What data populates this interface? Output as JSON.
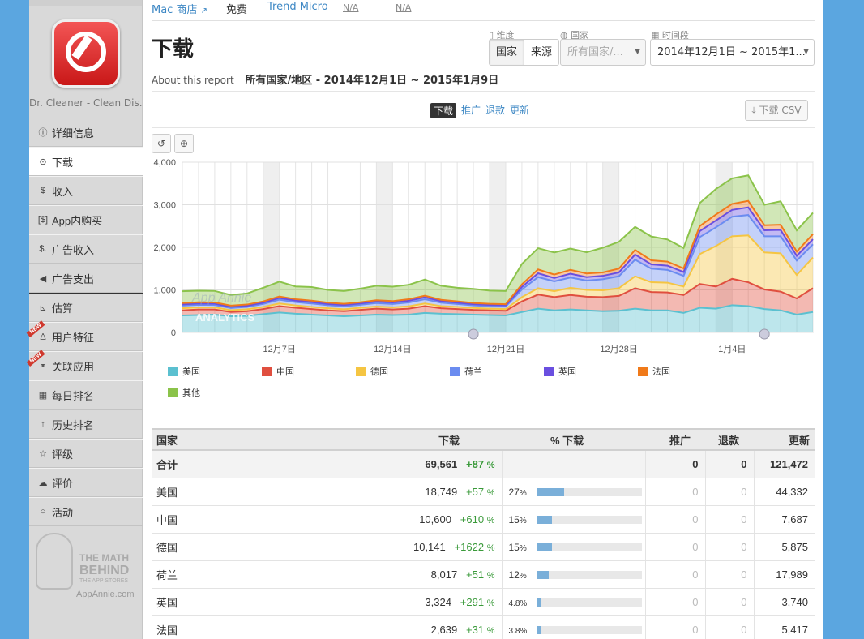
{
  "topbar": {
    "store": "Mac 商店",
    "price": "免费",
    "publisher": "Trend Micro",
    "na1": "N/A",
    "na2": "N/A"
  },
  "sidebar": {
    "app_name": "Dr. Cleaner - Clean Dis...",
    "items": [
      {
        "label": "详细信息",
        "icon": "info-icon"
      },
      {
        "label": "下载",
        "icon": "download-icon"
      },
      {
        "label": "收入",
        "icon": "dollar-icon"
      },
      {
        "label": "App内购买",
        "icon": "iap-icon"
      },
      {
        "label": "广告收入",
        "icon": "ad-revenue-icon"
      },
      {
        "label": "广告支出",
        "icon": "megaphone-icon"
      },
      {
        "label": "估算",
        "icon": "chart-icon"
      },
      {
        "label": "用户特征",
        "icon": "user-icon"
      },
      {
        "label": "关联应用",
        "icon": "link-icon"
      },
      {
        "label": "每日排名",
        "icon": "calendar-icon"
      },
      {
        "label": "历史排名",
        "icon": "arrow-up-icon"
      },
      {
        "label": "评级",
        "icon": "star-icon"
      },
      {
        "label": "评价",
        "icon": "comments-icon"
      },
      {
        "label": "活动",
        "icon": "comment-icon"
      }
    ],
    "new_badge": "NEW",
    "promo": {
      "t1": "THE MATH",
      "t2": "BEHIND",
      "t3": "THE APP STORES",
      "site": "AppAnnie.com"
    }
  },
  "header": {
    "title": "下载",
    "about": "About this report",
    "range": "所有国家/地区 - 2014年12月1日 ~ 2015年1月9日"
  },
  "filters": {
    "dim_label": "维度",
    "dim_options": [
      "国家",
      "来源"
    ],
    "country_label": "国家",
    "country_value": "所有国家/...",
    "period_label": "时间段",
    "period_value": "2014年12月1日 ~ 2015年1..."
  },
  "tabs": [
    "下载",
    "推广",
    "退款",
    "更新"
  ],
  "csv_label": "下载 CSV",
  "watermark": {
    "line1": "App Annie",
    "line2": "ANALYTICS"
  },
  "chart_data": {
    "type": "area",
    "x": [
      "2014-12-01",
      "2014-12-02",
      "2014-12-03",
      "2014-12-04",
      "2014-12-05",
      "2014-12-06",
      "2014-12-07",
      "2014-12-08",
      "2014-12-09",
      "2014-12-10",
      "2014-12-11",
      "2014-12-12",
      "2014-12-13",
      "2014-12-14",
      "2014-12-15",
      "2014-12-16",
      "2014-12-17",
      "2014-12-18",
      "2014-12-19",
      "2014-12-20",
      "2014-12-21",
      "2014-12-22",
      "2014-12-23",
      "2014-12-24",
      "2014-12-25",
      "2014-12-26",
      "2014-12-27",
      "2014-12-28",
      "2014-12-29",
      "2014-12-30",
      "2014-12-31",
      "2015-01-01",
      "2015-01-02",
      "2015-01-03",
      "2015-01-04",
      "2015-01-05",
      "2015-01-06",
      "2015-01-07",
      "2015-01-08",
      "2015-01-09"
    ],
    "xticks": [
      "12月7日",
      "12月14日",
      "12月21日",
      "12月28日",
      "1月4日"
    ],
    "ylim": [
      0,
      4000
    ],
    "yticks": [
      "0",
      "1,000",
      "2,000",
      "3,000",
      "4,000"
    ],
    "stacked": true,
    "series": [
      {
        "name": "美国",
        "color": "#5bc0d0",
        "values": [
          400,
          410,
          420,
          380,
          390,
          430,
          470,
          440,
          420,
          400,
          380,
          400,
          420,
          410,
          420,
          460,
          440,
          430,
          420,
          410,
          400,
          480,
          560,
          520,
          540,
          520,
          500,
          510,
          560,
          520,
          520,
          460,
          580,
          560,
          640,
          620,
          550,
          520,
          420,
          480
        ]
      },
      {
        "name": "中国",
        "color": "#e04f3f",
        "values": [
          120,
          130,
          120,
          100,
          110,
          120,
          150,
          140,
          130,
          120,
          120,
          130,
          140,
          130,
          140,
          160,
          130,
          120,
          110,
          110,
          110,
          250,
          330,
          310,
          340,
          320,
          330,
          350,
          480,
          430,
          420,
          420,
          560,
          520,
          620,
          560,
          460,
          440,
          380,
          560
        ]
      },
      {
        "name": "德国",
        "color": "#f5c542",
        "values": [
          50,
          50,
          50,
          45,
          45,
          50,
          60,
          55,
          50,
          50,
          45,
          50,
          50,
          50,
          55,
          60,
          50,
          50,
          45,
          40,
          40,
          100,
          150,
          140,
          170,
          160,
          160,
          180,
          280,
          230,
          230,
          200,
          700,
          950,
          1000,
          1100,
          870,
          900,
          550,
          720
        ]
      },
      {
        "name": "荷兰",
        "color": "#6b8cf0",
        "values": [
          60,
          60,
          55,
          50,
          55,
          70,
          90,
          80,
          80,
          70,
          70,
          70,
          80,
          80,
          90,
          100,
          80,
          70,
          60,
          60,
          60,
          180,
          260,
          230,
          240,
          220,
          260,
          280,
          390,
          320,
          300,
          250,
          400,
          440,
          460,
          480,
          380,
          400,
          340,
          310
        ]
      },
      {
        "name": "英国",
        "color": "#6a4fe0",
        "values": [
          30,
          30,
          30,
          28,
          28,
          30,
          40,
          35,
          35,
          30,
          30,
          30,
          35,
          35,
          40,
          45,
          35,
          30,
          30,
          28,
          28,
          60,
          90,
          80,
          90,
          80,
          80,
          90,
          120,
          100,
          100,
          90,
          140,
          160,
          160,
          180,
          140,
          150,
          110,
          120
        ]
      },
      {
        "name": "法国",
        "color": "#f07a1a",
        "values": [
          30,
          30,
          30,
          28,
          28,
          30,
          35,
          32,
          32,
          30,
          30,
          30,
          32,
          32,
          35,
          38,
          32,
          30,
          28,
          26,
          26,
          60,
          90,
          80,
          90,
          85,
          80,
          90,
          110,
          95,
          95,
          85,
          120,
          140,
          140,
          150,
          120,
          120,
          100,
          120
        ]
      },
      {
        "name": "其他",
        "color": "#8bc34a",
        "values": [
          280,
          270,
          270,
          250,
          260,
          320,
          350,
          300,
          320,
          300,
          300,
          320,
          340,
          340,
          340,
          380,
          330,
          320,
          330,
          310,
          310,
          480,
          500,
          520,
          500,
          500,
          580,
          630,
          540,
          560,
          520,
          480,
          540,
          600,
          600,
          600,
          480,
          550,
          500,
          500
        ]
      }
    ]
  },
  "table": {
    "headers": [
      "国家",
      "下载",
      "% 下载",
      "推广",
      "退款",
      "更新"
    ],
    "total": {
      "label": "合计",
      "downloads": "69,561",
      "change": "+87",
      "promo": "0",
      "refunds": "0",
      "updates": "121,472"
    },
    "rows": [
      {
        "country": "美国",
        "downloads": "18,749",
        "change": "+57",
        "pct": "27",
        "share": 0.27,
        "promo": "0",
        "refunds": "0",
        "updates": "44,332"
      },
      {
        "country": "中国",
        "downloads": "10,600",
        "change": "+610",
        "pct": "15",
        "share": 0.15,
        "promo": "0",
        "refunds": "0",
        "updates": "7,687"
      },
      {
        "country": "德国",
        "downloads": "10,141",
        "change": "+1622",
        "pct": "15",
        "share": 0.15,
        "promo": "0",
        "refunds": "0",
        "updates": "5,875"
      },
      {
        "country": "荷兰",
        "downloads": "8,017",
        "change": "+51",
        "pct": "12",
        "share": 0.12,
        "promo": "0",
        "refunds": "0",
        "updates": "17,989"
      },
      {
        "country": "英国",
        "downloads": "3,324",
        "change": "+291",
        "pct": "4.8",
        "share": 0.048,
        "promo": "0",
        "refunds": "0",
        "updates": "3,740"
      },
      {
        "country": "法国",
        "downloads": "2,639",
        "change": "+31",
        "pct": "3.8",
        "share": 0.038,
        "promo": "0",
        "refunds": "0",
        "updates": "5,417"
      }
    ],
    "pct_unit": "%"
  }
}
